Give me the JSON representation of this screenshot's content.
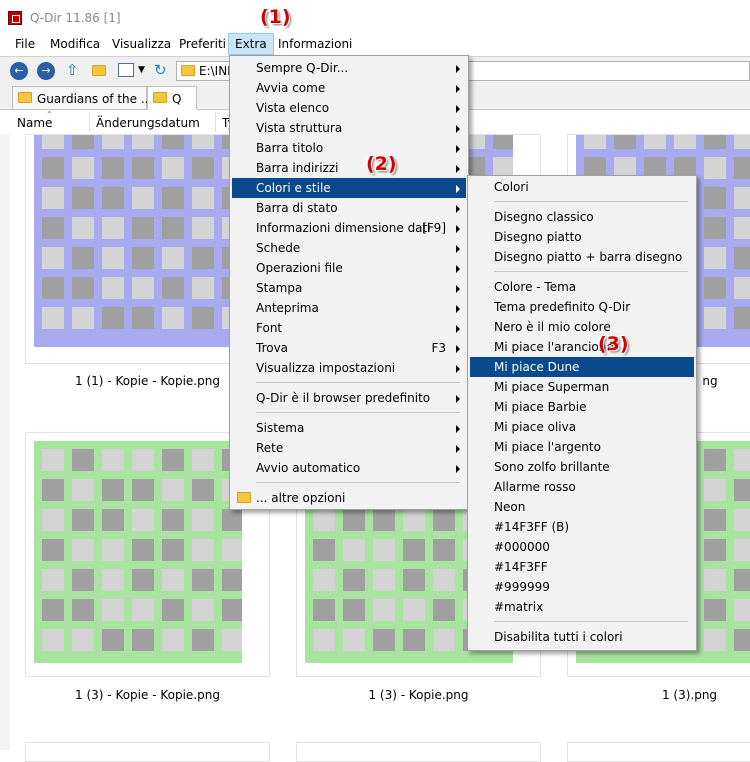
{
  "window": {
    "title": "Q-Dir 11.86 [1]"
  },
  "menubar": [
    "File",
    "Modifica",
    "Visualizza",
    "Preferiti",
    "Extra",
    "Informazioni"
  ],
  "address": {
    "path": "E:\\INE"
  },
  "tabs": [
    "Guardians of the ...",
    "Q"
  ],
  "columns": [
    "Name",
    "Änderungsdatum",
    "Ty"
  ],
  "files": [
    {
      "name": "1 (1) - Kopie - Kopie.png"
    },
    {
      "name": "ng"
    },
    {
      "name": "1 (3) - Kopie - Kopie.png"
    },
    {
      "name": "1 (3) - Kopie.png"
    },
    {
      "name": "1 (3).png"
    }
  ],
  "thumb_colors": {
    "blue": "#a9a9f0",
    "green": "#a8e3a0",
    "gray": "#a0a0a0",
    "cell": "#d4d4d4"
  },
  "extra_menu": [
    {
      "label": "Sempre Q-Dir...",
      "arrow": true
    },
    {
      "label": "Avvia come",
      "arrow": true
    },
    {
      "label": "Vista elenco",
      "arrow": true
    },
    {
      "label": "Vista struttura",
      "arrow": true
    },
    {
      "label": "Barra titolo",
      "arrow": true
    },
    {
      "label": "Barra indirizzi",
      "arrow": true
    },
    {
      "label": "Colori e stile",
      "arrow": true,
      "highlight": true
    },
    {
      "label": "Barra di stato",
      "arrow": true
    },
    {
      "label": "Informazioni dimensione dati",
      "shortcut": "[F9]",
      "arrow": true
    },
    {
      "label": "Schede",
      "arrow": true
    },
    {
      "label": "Operazioni file",
      "arrow": true
    },
    {
      "label": "Stampa",
      "arrow": true
    },
    {
      "label": "Anteprima",
      "arrow": true
    },
    {
      "label": "Font",
      "arrow": true
    },
    {
      "label": "Trova",
      "shortcut": "F3",
      "arrow": true
    },
    {
      "label": "Visualizza impostazioni",
      "arrow": true
    },
    {
      "separator": true
    },
    {
      "label": "Q-Dir è il browser predefinito",
      "arrow": true
    },
    {
      "separator": true
    },
    {
      "label": "Sistema",
      "arrow": true
    },
    {
      "label": "Rete",
      "arrow": true
    },
    {
      "label": "Avvio automatico",
      "arrow": true
    },
    {
      "separator": true
    },
    {
      "label": "... altre opzioni",
      "icon": "folder-icon"
    }
  ],
  "colors_menu": [
    {
      "label": "Colori"
    },
    {
      "separator": true
    },
    {
      "label": "Disegno classico"
    },
    {
      "label": "Disegno piatto"
    },
    {
      "label": "Disegno piatto + barra disegno"
    },
    {
      "separator": true
    },
    {
      "label": "Colore - Tema"
    },
    {
      "label": "Tema predefinito Q-Dir"
    },
    {
      "label": "Nero è il mio colore"
    },
    {
      "label": "Mi piace l'arancione"
    },
    {
      "label": "Mi piace Dune",
      "highlight": true
    },
    {
      "label": "Mi piace Superman"
    },
    {
      "label": "Mi piace Barbie"
    },
    {
      "label": "Mi piace oliva"
    },
    {
      "label": "Mi piace l'argento"
    },
    {
      "label": "Sono zolfo brillante"
    },
    {
      "label": "Allarme rosso"
    },
    {
      "label": "Neon"
    },
    {
      "label": "#14F3FF (B)"
    },
    {
      "label": "#000000"
    },
    {
      "label": "#14F3FF"
    },
    {
      "label": "#999999"
    },
    {
      "label": "#matrix"
    },
    {
      "separator": true
    },
    {
      "label": "Disabilita tutti i colori"
    }
  ],
  "callouts": [
    "(1)",
    "(2)",
    "(3)"
  ],
  "accent": {
    "highlight": "#0a4a8c",
    "menu_active": "#cce4f7",
    "callout": "#d10000"
  }
}
